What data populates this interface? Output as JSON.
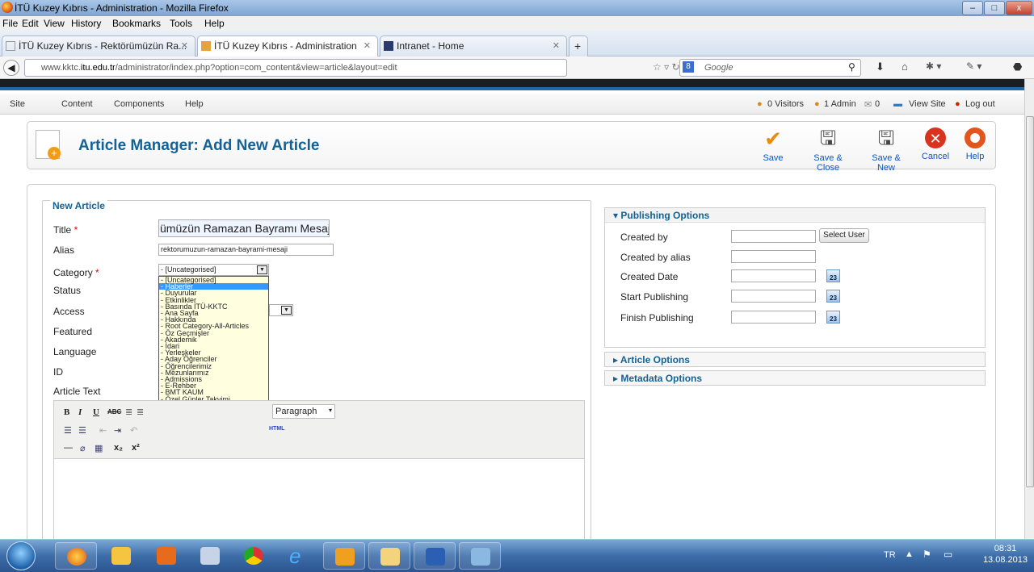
{
  "window": {
    "title": "İTÜ Kuzey Kıbrıs - Administration - Mozilla Firefox",
    "min": "–",
    "max": "□",
    "close": "x"
  },
  "menubar": [
    "File",
    "Edit",
    "View",
    "History",
    "Bookmarks",
    "Tools",
    "Help"
  ],
  "tabs": [
    {
      "label": "İTÜ Kuzey Kıbrıs - Rektörümüzün Ra...",
      "active": false
    },
    {
      "label": "İTÜ Kuzey Kıbrıs - Administration",
      "active": true
    },
    {
      "label": "Intranet - Home",
      "active": false
    }
  ],
  "new_tab": "+",
  "address": {
    "pre": "www.kktc.",
    "host": "itu.edu.tr",
    "post": "/administrator/index.php?option=com_content&view=article&layout=edit"
  },
  "search": {
    "placeholder": "Google"
  },
  "admin_menu": [
    "Site",
    "Content",
    "Components",
    "Help"
  ],
  "status": {
    "visitors": "0 Visitors",
    "admins": "1 Admin",
    "messages": "0",
    "view_site": "View Site",
    "logout": "Log out"
  },
  "header": {
    "title": "Article Manager: Add New Article"
  },
  "toolbar": {
    "save": "Save",
    "save_close": "Save & Close",
    "save_new": "Save & New",
    "cancel": "Cancel",
    "help": "Help"
  },
  "form": {
    "legend": "New Article",
    "title_label": "Title",
    "title_value": "ümüzün Ramazan Bayramı Mesajı",
    "alias_label": "Alias",
    "alias_value": "rektorumuzun-ramazan-bayrami-mesaji",
    "category_label": "Category",
    "category_value": "- [Uncategorised]",
    "status_label": "Status",
    "access_label": "Access",
    "featured_label": "Featured",
    "language_label": "Language",
    "id_label": "ID",
    "text_label": "Article Text",
    "required_mark": "*"
  },
  "category_options": [
    "- [Uncategorised]",
    "- Haberler",
    "- Duyurular",
    "- Etkinlikler",
    "- Basında İTÜ-KKTC",
    "- Ana Sayfa",
    "- Hakkında",
    "- Root Category-All-Articles",
    "- Öz Geçmişler",
    "- Akademik",
    "- İdari",
    "- Yerleşkeler",
    "- Aday Öğrenciler",
    "- Öğrencilerimiz",
    "- Mezunlarımız",
    "- Admissions",
    "- E-Rehber",
    "- BMT KAUM",
    "- Özel Günler Takvimi"
  ],
  "category_selected_index": 1,
  "editor": {
    "format": "Paragraph",
    "html": "HTML",
    "bold": "B",
    "italic": "I",
    "underline": "U",
    "strike": "ABC",
    "sub": "x₂",
    "sup": "x²"
  },
  "publishing": {
    "title": "Publishing Options",
    "created_by": "Created by",
    "select_user": "Select User",
    "created_by_alias": "Created by alias",
    "created_date": "Created Date",
    "start_publishing": "Start Publishing",
    "finish_publishing": "Finish Publishing",
    "cal": "23"
  },
  "article_options": "Article Options",
  "metadata_options": "Metadata Options",
  "taskbar": {
    "lang": "TR",
    "time": "08:31",
    "date": "13.08.2013"
  },
  "colors": {
    "accent": "#146295",
    "taskbar": "#3d6da8",
    "selection": "#3399ff"
  }
}
